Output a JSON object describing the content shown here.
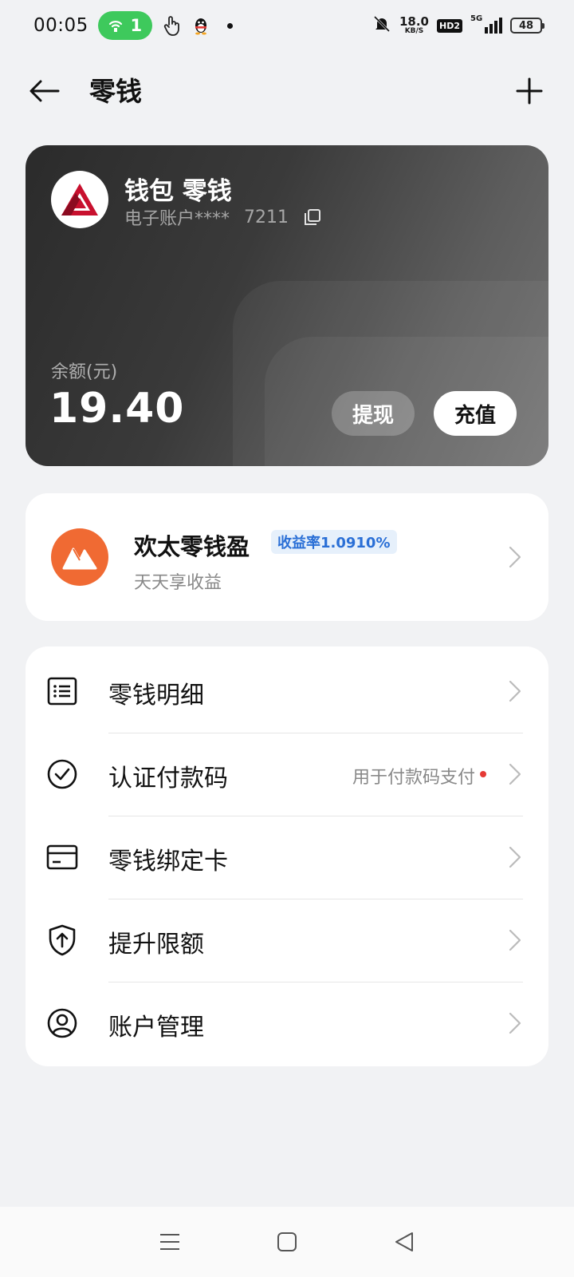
{
  "status_bar": {
    "time": "00:05",
    "hotspot_count": "1",
    "speed_value": "18.0",
    "speed_unit": "KB/S",
    "hd_label": "HD2",
    "network": "5G",
    "battery": "48"
  },
  "header": {
    "title": "零钱"
  },
  "balance_card": {
    "name": "钱包 零钱",
    "account_label": "电子账户****",
    "account_suffix": "7211",
    "balance_label": "余额(元)",
    "balance_amount": "19.40",
    "withdraw_label": "提现",
    "recharge_label": "充值"
  },
  "savings": {
    "title": "欢太零钱盈",
    "badge": "收益率1.0910%",
    "subtitle": "天天享收益"
  },
  "menu": {
    "items": [
      {
        "label": "零钱明细",
        "icon": "list-icon"
      },
      {
        "label": "认证付款码",
        "icon": "check-circle-icon",
        "hint": "用于付款码支付"
      },
      {
        "label": "零钱绑定卡",
        "icon": "card-icon"
      },
      {
        "label": "提升限额",
        "icon": "shield-up-icon"
      },
      {
        "label": "账户管理",
        "icon": "user-circle-icon"
      }
    ]
  },
  "colors": {
    "accent_green": "#3ec95c",
    "savings_orange": "#f06a33",
    "badge_blue": "#2a6fd6",
    "dot_red": "#e53935"
  }
}
